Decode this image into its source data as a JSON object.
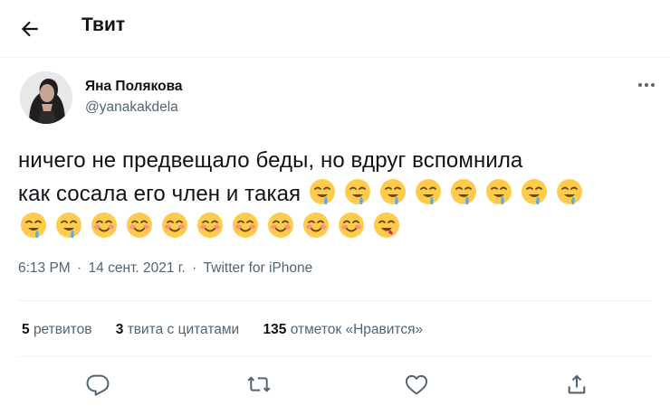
{
  "header": {
    "title": "Твит",
    "back_icon": "arrow-left-icon"
  },
  "author": {
    "name": "Яна Полякова",
    "handle": "@yanakakdela",
    "avatar": "profile-photo"
  },
  "tweet": {
    "text_line1": "ничего не предвещало беды, но вдруг вспомнила",
    "text_line2": "как сосала его член и такая",
    "emoji_drool_count": 10,
    "emoji_blush_count": 8,
    "emoji_yum_count": 1
  },
  "meta": {
    "time": "6:13 PM",
    "sep1": "·",
    "date": "14 сент. 2021 г.",
    "sep2": "·",
    "source": "Twitter for iPhone"
  },
  "stats": {
    "retweets_count": "5",
    "retweets_label": "ретвитов",
    "quotes_count": "3",
    "quotes_label": "твита с цитатами",
    "likes_count": "135",
    "likes_label": "отметок «Нравится»"
  },
  "actions": [
    "reply-icon",
    "retweet-icon",
    "like-icon",
    "share-icon"
  ],
  "colors": {
    "text": "#0f1419",
    "secondary": "#536471",
    "border": "#eff3f4",
    "emoji": "#ffcb4c"
  }
}
